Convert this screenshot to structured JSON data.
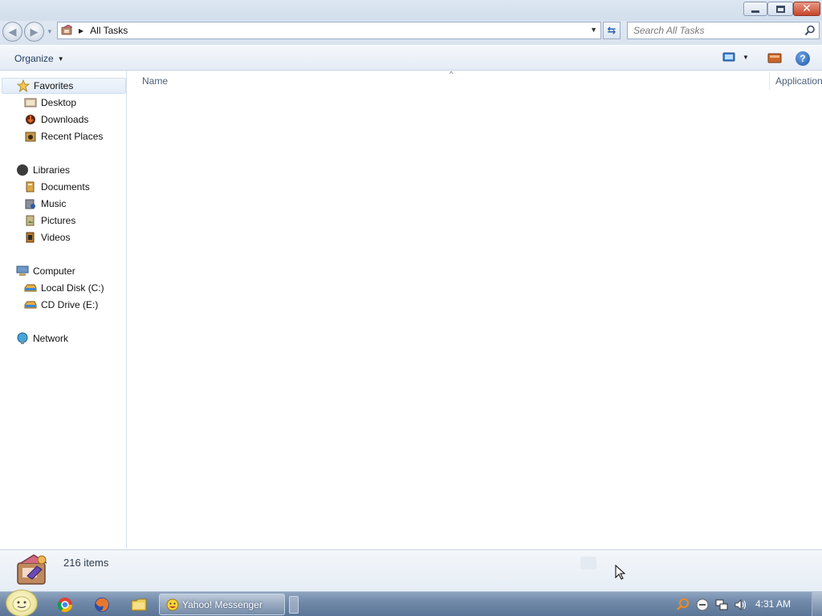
{
  "window": {
    "minimize_icon": "minimize-icon",
    "maximize_icon": "restore-icon",
    "close_icon": "close-icon"
  },
  "address_bar": {
    "location_icon": "control-panel-icon",
    "path": "All Tasks",
    "refresh_icon": "refresh-icon"
  },
  "search": {
    "placeholder": "Search All Tasks",
    "icon": "search-icon"
  },
  "command_bar": {
    "organize_label": "Organize",
    "view_icon": "change-view-icon",
    "preview_icon": "preview-pane-icon",
    "help_label": "?"
  },
  "nav_pane": {
    "favorites": {
      "label": "Favorites",
      "items": [
        {
          "label": "Desktop"
        },
        {
          "label": "Downloads"
        },
        {
          "label": "Recent Places"
        }
      ]
    },
    "libraries": {
      "label": "Libraries",
      "items": [
        {
          "label": "Documents"
        },
        {
          "label": "Music"
        },
        {
          "label": "Pictures"
        },
        {
          "label": "Videos"
        }
      ]
    },
    "computer": {
      "label": "Computer",
      "items": [
        {
          "label": "Local Disk (C:)"
        },
        {
          "label": "CD Drive (E:)"
        }
      ]
    },
    "network": {
      "label": "Network"
    }
  },
  "content": {
    "columns": [
      "Name",
      "Application"
    ],
    "sort_indicator": "^",
    "rows": []
  },
  "details_pane": {
    "item_count": "216 items"
  },
  "taskbar": {
    "open_app_label": "Yahoo! Messenger",
    "clock": "4:31 AM"
  },
  "colors": {
    "titlebar": "#d3deec",
    "accent": "#2d67b0",
    "taskbar": "#6f88a8"
  }
}
